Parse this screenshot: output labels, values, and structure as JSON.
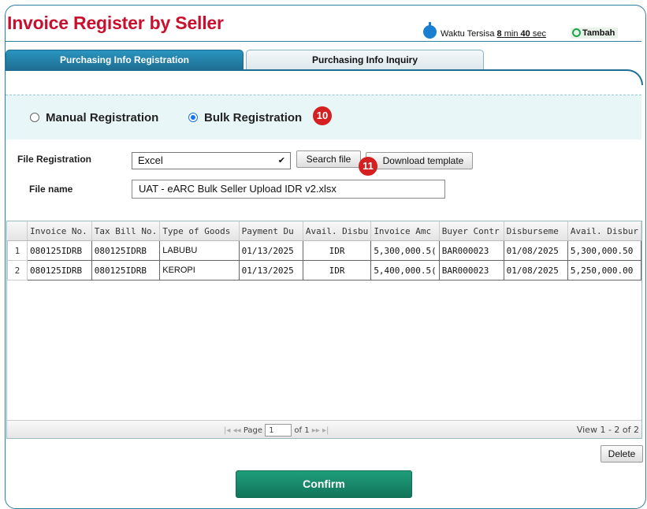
{
  "page_title": "Invoice Register by Seller",
  "timer": {
    "prefix": "Waktu Tersisa",
    "minutes": "8",
    "min_label": "min",
    "seconds": "40",
    "sec_label": "sec",
    "extend_label": "Tambah"
  },
  "tabs": [
    {
      "label": "Purchasing Info Registration",
      "active": true
    },
    {
      "label": "Purchasing Info Inquiry",
      "active": false
    }
  ],
  "registration_mode": {
    "options": [
      {
        "label": "Manual Registration",
        "selected": false
      },
      {
        "label": "Bulk Registration",
        "selected": true
      }
    ],
    "step_badge": "10"
  },
  "file_registration": {
    "label": "File Registration",
    "selected": "Excel",
    "search_button": "Search file",
    "download_button": "Download template",
    "step_badge": "11"
  },
  "file_name": {
    "label": "File name",
    "value": "UAT - eARC Bulk Seller Upload IDR v2.xlsx"
  },
  "grid": {
    "columns": [
      "Invoice No.",
      "Tax Bill No.",
      "Type of Goods",
      "Payment Du",
      "Avail. Disbu",
      "Invoice Amc",
      "Buyer Contr",
      "Disburseme",
      "Avail. Disbur"
    ],
    "rows": [
      {
        "num": "1",
        "cells": [
          "080125IDRB",
          "080125IDRB",
          "LABUBU",
          "01/13/2025",
          "IDR",
          "5,300,000.5(",
          "BAR000023",
          "01/08/2025",
          "5,300,000.50"
        ]
      },
      {
        "num": "2",
        "cells": [
          "080125IDRB",
          "080125IDRB",
          "KEROPI",
          "01/13/2025",
          "IDR",
          "5,400,000.5(",
          "BAR000023",
          "01/08/2025",
          "5,250,000.00"
        ]
      }
    ],
    "pager": {
      "first": "|◂",
      "prev": "◂◂",
      "page_label": "Page",
      "page": "1",
      "of_label": "of 1",
      "next": "▸▸",
      "last": "▸|",
      "view_text": "View 1 - 2 of 2"
    }
  },
  "delete_button": "Delete",
  "confirm_button": "Confirm",
  "colors": {
    "title": "#c8102e",
    "tab_active": "#1f6f94",
    "confirm": "#12745a",
    "badge": "#d42020"
  }
}
